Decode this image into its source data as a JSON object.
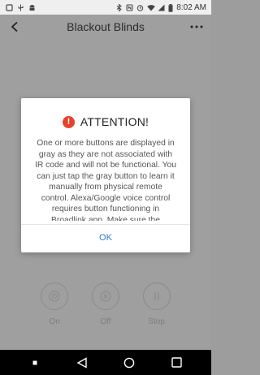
{
  "status_bar": {
    "time": "8:02 AM",
    "icons": [
      "notification-icon",
      "usb-icon",
      "android-icon",
      "bluetooth-icon",
      "nfc-icon",
      "alarm-icon",
      "wifi-icon",
      "signal-icon",
      "battery-icon"
    ]
  },
  "app_bar": {
    "title": "Blackout Blinds",
    "back_icon": "chevron-left-icon",
    "more_icon": "more-horizontal-icon"
  },
  "controls": [
    {
      "label": "On",
      "icon": "power-on-icon"
    },
    {
      "label": "Off",
      "icon": "power-off-icon"
    },
    {
      "label": "Stop",
      "icon": "pause-icon"
    }
  ],
  "dialog": {
    "title": "ATTENTION!",
    "icon": "alert-icon",
    "message": "One or more buttons are displayed in gray as they are not associated with IR code and will not be functional. You can just tap the gray button to learn it manually from physical remote control. Alexa/Google voice control requires button functioning in Broadlink app. Make sure the",
    "ok_label": "OK"
  },
  "colors": {
    "accent": "#2a7fd4",
    "alert": "#e5412d",
    "overlay": "#9f9f9f"
  }
}
